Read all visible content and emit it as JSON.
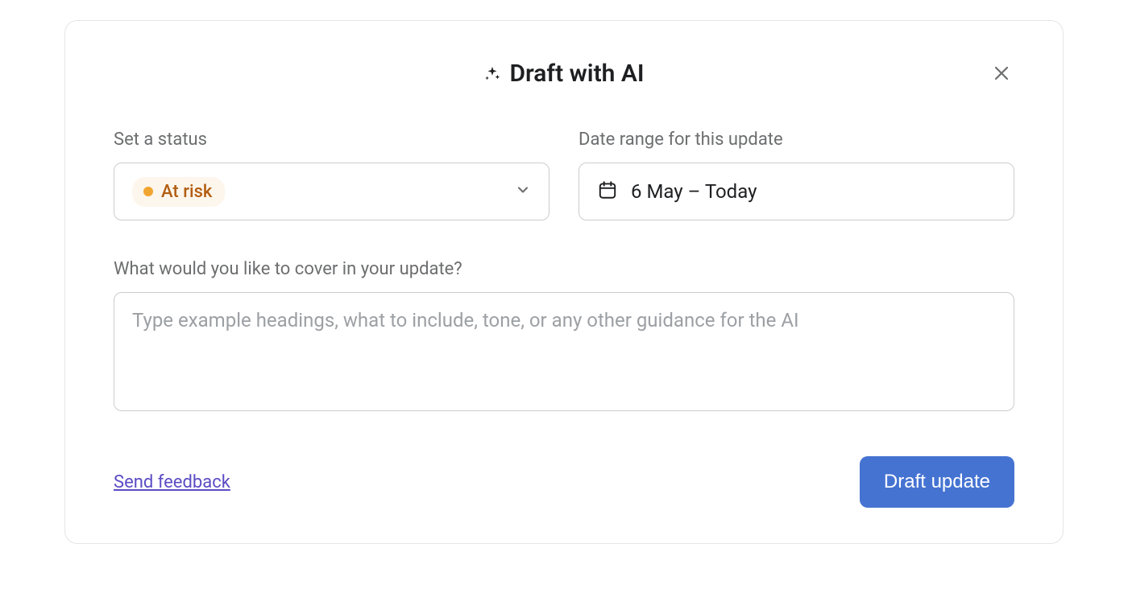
{
  "modal": {
    "title": "Draft with AI",
    "close_aria": "Close"
  },
  "status": {
    "label": "Set a status",
    "value": "At risk",
    "color": "#f1a531"
  },
  "date_range": {
    "label": "Date range for this update",
    "value": "6 May – Today"
  },
  "guidance": {
    "label": "What would you like to cover in your update?",
    "placeholder": "Type example headings, what to include, tone, or any other guidance for the AI",
    "value": ""
  },
  "footer": {
    "feedback_label": "Send feedback",
    "primary_label": "Draft update"
  }
}
